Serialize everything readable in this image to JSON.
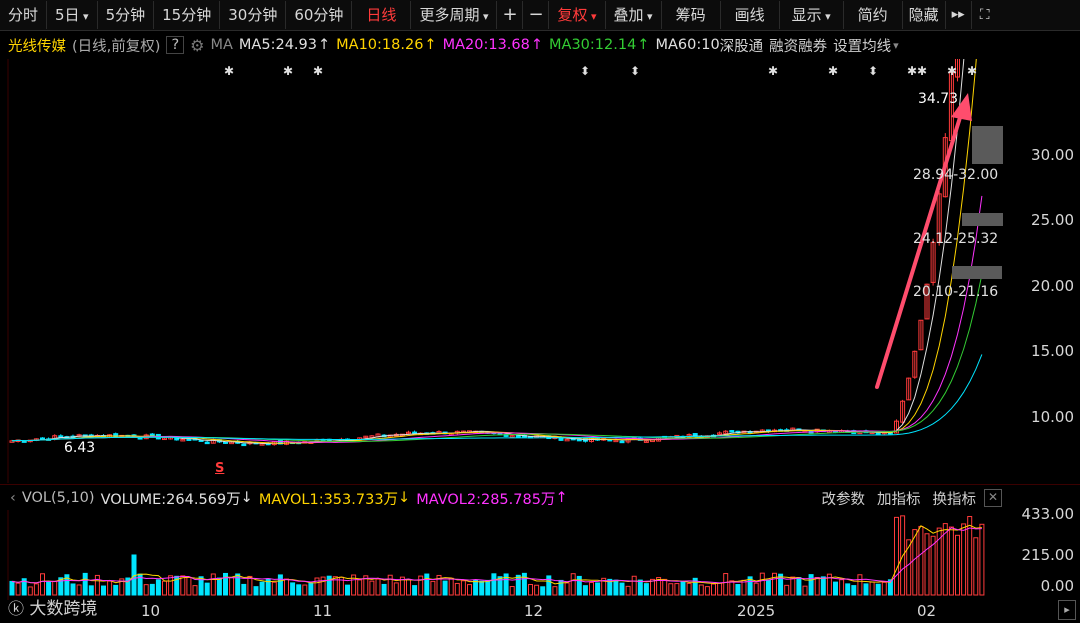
{
  "toolbar": {
    "items": [
      {
        "label": "分时"
      },
      {
        "label": "5日"
      },
      {
        "label": "5分钟"
      },
      {
        "label": "15分钟"
      },
      {
        "label": "30分钟"
      },
      {
        "label": "60分钟"
      },
      {
        "label": "日线"
      },
      {
        "label": "更多周期"
      },
      {
        "label": "+"
      },
      {
        "label": "−"
      },
      {
        "label": "复权"
      },
      {
        "label": "叠加"
      },
      {
        "label": "筹码"
      },
      {
        "label": "画线"
      },
      {
        "label": "显示"
      },
      {
        "label": "简约"
      },
      {
        "label": "隐藏"
      }
    ]
  },
  "ma_line": {
    "stock_name": "光线传媒",
    "mode": "(日线,前复权)",
    "help": "?",
    "ma_label": "MA",
    "ma5": "MA5:24.93",
    "ma10": "MA10:18.26",
    "ma20": "MA20:13.68",
    "ma30": "MA30:12.14",
    "ma60": "MA60:10",
    "shen": "深股通",
    "rongzi": "融资融券",
    "setting": "设置均线",
    "colors": {
      "ma5": "#e0e0e0",
      "ma10": "#ffd400",
      "ma20": "#ff33ff",
      "ma30": "#33cc33",
      "ma60": "#e0e0e0"
    }
  },
  "price_axis": {
    "labels": [
      "30.00",
      "25.00",
      "20.00",
      "15.00",
      "10.00"
    ]
  },
  "price_annotations": {
    "high": "34.73",
    "low": "6.43",
    "chip1": "28.94-32.00",
    "chip2": "24.12-25.32",
    "chip3": "20.10-21.16",
    "s_marker": "S"
  },
  "vol_line": {
    "label": "VOL(5,10)",
    "volume": "VOLUME:264.569万",
    "mavol1": "MAVOL1:353.733万",
    "mavol2": "MAVOL2:285.785万",
    "change_params": "改参数",
    "add_indicator": "加指标",
    "switch_indicator": "换指标",
    "colors": {
      "volume": "#e0e0e0",
      "mavol1": "#ffd400",
      "mavol2": "#ff33ff"
    }
  },
  "vol_axis": {
    "labels": [
      "433.00",
      "215.00",
      "0.00"
    ]
  },
  "x_axis": {
    "labels": [
      "10",
      "11",
      "12",
      "2025",
      "02"
    ]
  },
  "watermark": "大数跨境",
  "colors": {
    "up": "#ff3b3b",
    "down": "#00e5ff",
    "bg": "#000000",
    "arrow": "#ff4d6d"
  }
}
